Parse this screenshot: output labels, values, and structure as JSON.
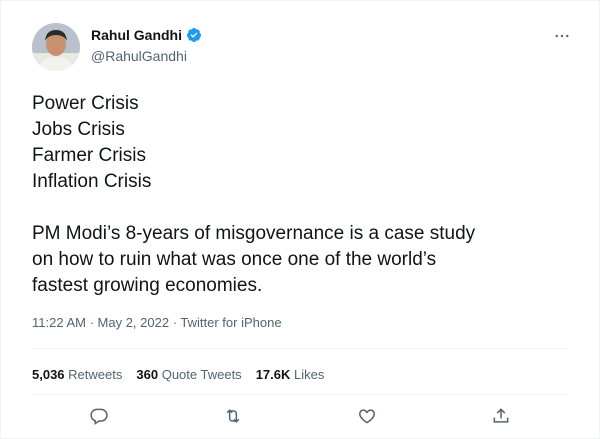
{
  "author": {
    "display_name": "Rahul Gandhi",
    "handle": "@RahulGandhi",
    "verified": true,
    "avatar_icon": "person-avatar",
    "verified_color": "#1d9bf0"
  },
  "tweet": {
    "lines": [
      "Power Crisis",
      "Jobs Crisis",
      "Farmer Crisis",
      "Inflation Crisis"
    ],
    "paragraph": [
      "PM Modi’s 8-years of misgovernance is a case study",
      "on how to ruin what was once one of the world’s",
      "fastest growing economies."
    ]
  },
  "meta": {
    "time": "11:22 AM",
    "date": "May 2, 2022",
    "source": "Twitter for iPhone",
    "separator": " · "
  },
  "stats": {
    "retweets_count": "5,036",
    "retweets_label": "Retweets",
    "quotes_count": "360",
    "quotes_label": "Quote Tweets",
    "likes_count": "17.6K",
    "likes_label": "Likes"
  },
  "actions": [
    "reply-icon",
    "retweet-icon",
    "like-icon",
    "share-icon"
  ],
  "colors": {
    "text": "#0f1419",
    "secondary": "#536471",
    "divider": "#eff3f4"
  }
}
